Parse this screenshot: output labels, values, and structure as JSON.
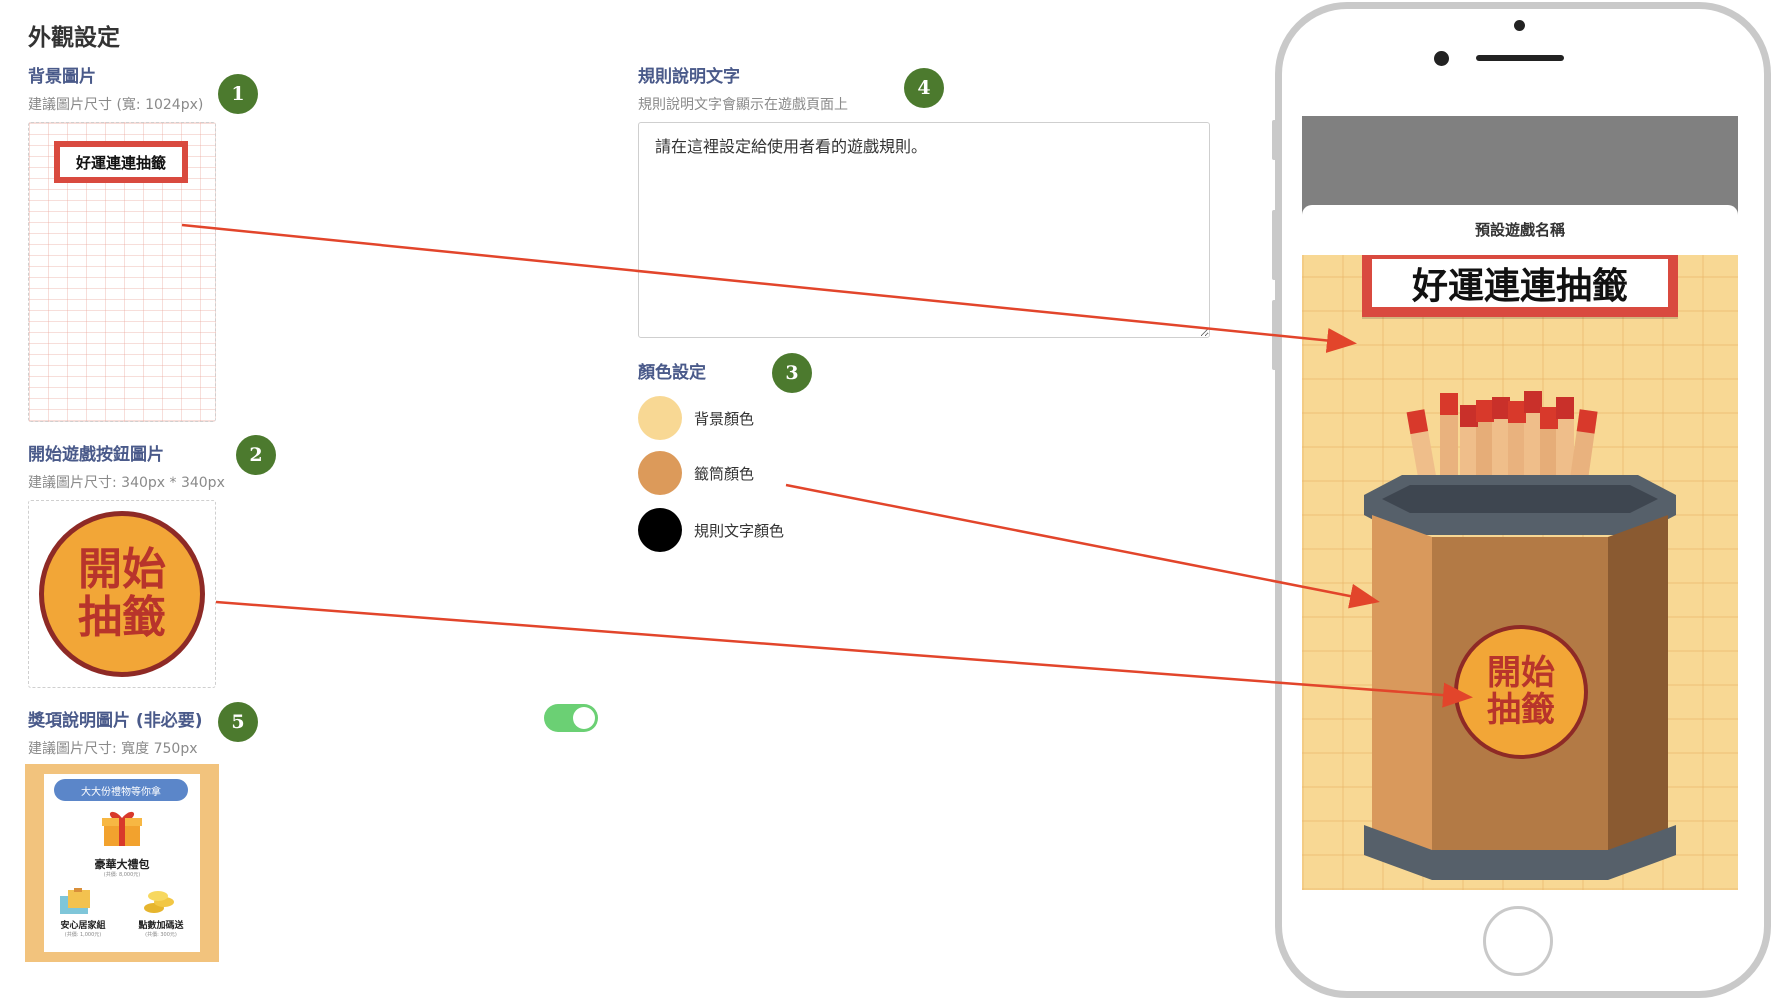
{
  "page_title": "外觀設定",
  "background_image": {
    "label": "背景圖片",
    "hint": "建議圖片尺寸 (寬: 1024px)",
    "badge": "1",
    "preview_title": "好運連連抽籤"
  },
  "start_button_image": {
    "label": "開始遊戲按鈕圖片",
    "hint": "建議圖片尺寸: 340px * 340px",
    "badge": "2",
    "button_line1": "開始",
    "button_line2": "抽籤"
  },
  "prize_image": {
    "label": "獎項說明圖片 (非必要)",
    "hint": "建議圖片尺寸: 寬度 750px",
    "badge": "5",
    "toggle_on": true,
    "banner": "大大份禮物等你拿",
    "main_prize": "豪華大禮包",
    "main_prize_sub": "(共價: 8,000元)",
    "prize_left": "安心居家組",
    "prize_left_sub": "(共價: 1,000元)",
    "prize_right": "點數加碼送",
    "prize_right_sub": "(共價: 300元)"
  },
  "rules_text": {
    "label": "規則說明文字",
    "hint": "規則說明文字會顯示在遊戲頁面上",
    "badge": "4",
    "value": "請在這裡設定給使用者看的遊戲規則。"
  },
  "color_settings": {
    "label": "顏色設定",
    "badge": "3",
    "items": [
      {
        "label": "背景顏色",
        "color": "#f8d894"
      },
      {
        "label": "籤筒顏色",
        "color": "#dc9a5a"
      },
      {
        "label": "規則文字顏色",
        "color": "#000000"
      }
    ]
  },
  "phone_preview": {
    "game_name": "預設遊戲名稱",
    "title": "好運連連抽籤",
    "button_line1": "開始",
    "button_line2": "抽籤"
  },
  "colors": {
    "accent_green": "#4c7a2e",
    "arrow_red": "#e2452b",
    "toggle_green": "#6bd074",
    "label_blue": "#4a5a8a"
  }
}
